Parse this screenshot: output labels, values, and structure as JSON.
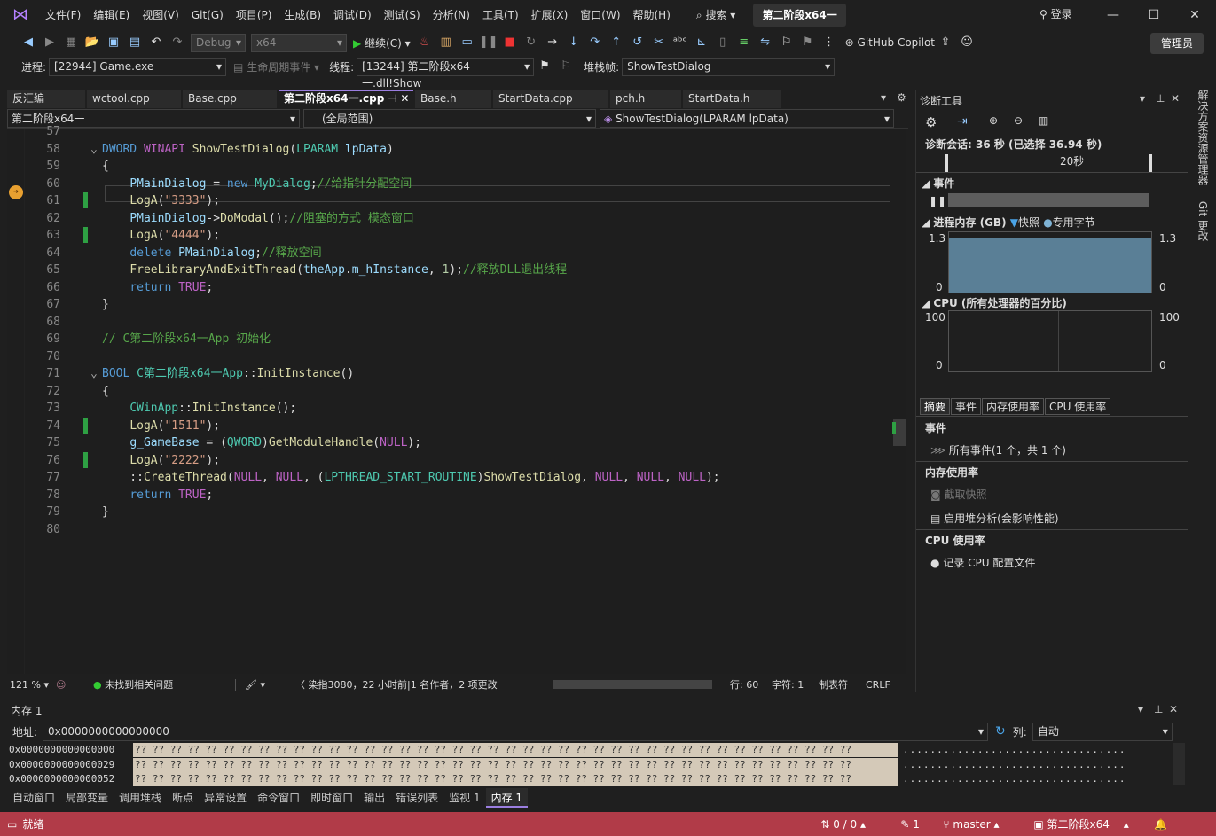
{
  "menu": [
    "文件(F)",
    "编辑(E)",
    "视图(V)",
    "Git(G)",
    "项目(P)",
    "生成(B)",
    "调试(D)",
    "测试(S)",
    "分析(N)",
    "工具(T)",
    "扩展(X)",
    "窗口(W)",
    "帮助(H)"
  ],
  "search_label": "搜索",
  "project_title": "第二阶段x64一",
  "login_label": "登录",
  "toolbar": {
    "config": "Debug",
    "platform": "x64",
    "continue_label": "继续(C)",
    "copilot_label": "GitHub Copilot",
    "admin_label": "管理员"
  },
  "debugbar": {
    "process_label": "进程:",
    "process_value": "[22944] Game.exe",
    "lifecycle_label": "生命周期事件",
    "thread_label": "线程:",
    "thread_value": "[13244] 第二阶段x64一.dll!Show",
    "stack_label": "堆栈帧:",
    "stack_value": "ShowTestDialog"
  },
  "tabs": [
    {
      "label": "反汇编",
      "active": false
    },
    {
      "label": "wctool.cpp",
      "active": false
    },
    {
      "label": "Base.cpp",
      "active": false
    },
    {
      "label": "第二阶段x64一.cpp",
      "active": true
    },
    {
      "label": "Base.h",
      "active": false
    },
    {
      "label": "StartData.cpp",
      "active": false
    },
    {
      "label": "pch.h",
      "active": false
    },
    {
      "label": "StartData.h",
      "active": false
    }
  ],
  "navbar": {
    "project": "第二阶段x64一",
    "scope": "(全局范围)",
    "function": "ShowTestDialog(LPARAM lpData)"
  },
  "editor": {
    "lines": [
      {
        "n": "57",
        "html": ""
      },
      {
        "n": "58",
        "html": "<span class='kw'>DWORD</span> <span class='mc'>WINAPI</span> <span class='fn'>ShowTestDialog</span>(<span class='ty'>LPARAM</span> <span class='mb'>lpData</span>)"
      },
      {
        "n": "59",
        "html": "{"
      },
      {
        "n": "60",
        "html": "    <span class='mb'>PMainDialog</span> = <span class='kw'>new</span> <span class='ty'>MyDialog</span>;<span class='cm'>//给指针分配空间</span>"
      },
      {
        "n": "61",
        "html": "    <span class='fn'>LogA</span>(<span class='st'>\"3333\"</span>);"
      },
      {
        "n": "62",
        "html": "    <span class='mb'>PMainDialog</span>-&gt;<span class='fn'>DoModal</span>();<span class='cm'>//阻塞的方式 模态窗口</span>"
      },
      {
        "n": "63",
        "html": "    <span class='fn'>LogA</span>(<span class='st'>\"4444\"</span>);"
      },
      {
        "n": "64",
        "html": "    <span class='kw'>delete</span> <span class='mb'>PMainDialog</span>;<span class='cm'>//释放空间</span>"
      },
      {
        "n": "65",
        "html": "    <span class='fn'>FreeLibraryAndExitThread</span>(<span class='mb'>theApp</span>.<span class='mb'>m_hInstance</span>, <span class='nu'>1</span>);<span class='cm'>//释放DLL退出线程</span>"
      },
      {
        "n": "66",
        "html": "    <span class='kw'>return</span> <span class='mc'>TRUE</span>;"
      },
      {
        "n": "67",
        "html": "}"
      },
      {
        "n": "68",
        "html": ""
      },
      {
        "n": "69",
        "html": "<span class='cm'>// C第二阶段x64一App 初始化</span>"
      },
      {
        "n": "70",
        "html": ""
      },
      {
        "n": "71",
        "html": "<span class='kw'>BOOL</span> <span class='ty'>C第二阶段x64一App</span>::<span class='fn'>InitInstance</span>()"
      },
      {
        "n": "72",
        "html": "{"
      },
      {
        "n": "73",
        "html": "    <span class='ty'>CWinApp</span>::<span class='fn'>InitInstance</span>();"
      },
      {
        "n": "74",
        "html": "    <span class='fn'>LogA</span>(<span class='st'>\"1511\"</span>);"
      },
      {
        "n": "75",
        "html": "    <span class='mb'>g_GameBase</span> = (<span class='ty'>QWORD</span>)<span class='fn'>GetModuleHandle</span>(<span class='mc'>NULL</span>);"
      },
      {
        "n": "76",
        "html": "    <span class='fn'>LogA</span>(<span class='st'>\"2222\"</span>);"
      },
      {
        "n": "77",
        "html": "    ::<span class='fn'>CreateThread</span>(<span class='mc'>NULL</span>, <span class='mc'>NULL</span>, (<span class='ty'>LPTHREAD_START_ROUTINE</span>)<span class='fn'>ShowTestDialog</span>, <span class='mc'>NULL</span>, <span class='mc'>NULL</span>, <span class='mc'>NULL</span>);"
      },
      {
        "n": "78",
        "html": "    <span class='kw'>return</span> <span class='mc'>TRUE</span>;"
      },
      {
        "n": "79",
        "html": "}"
      },
      {
        "n": "80",
        "html": ""
      }
    ]
  },
  "editor_status": {
    "zoom": "121 %",
    "issues": "未找到相关问题",
    "blame": "染指3080，22 小时前|1 名作者，2 项更改",
    "line": "行: 60",
    "char": "字符: 1",
    "tab": "制表符",
    "eol": "CRLF"
  },
  "diag": {
    "title": "诊断工具",
    "session": "诊断会话: 36 秒 (已选择 36.94 秒)",
    "timeline_label": "20秒",
    "events_label": "事件",
    "memory_label": "进程内存 (GB)",
    "snapshot_label": "快照",
    "private_label": "专用字节",
    "mem_max_left": "1.3",
    "mem_min_left": "0",
    "mem_max_right": "1.3",
    "mem_min_right": "0",
    "cpu_label": "CPU (所有处理器的百分比)",
    "cpu_max_left": "100",
    "cpu_min_left": "0",
    "cpu_max_right": "100",
    "cpu_min_right": "0",
    "tabs": [
      "摘要",
      "事件",
      "内存使用率",
      "CPU 使用率"
    ],
    "sec_events": "事件",
    "all_events": "所有事件(1 个，共 1 个)",
    "sec_memory": "内存使用率",
    "take_snapshot": "截取快照",
    "heap_profiling": "启用堆分析(会影响性能)",
    "sec_cpu": "CPU 使用率",
    "record_cpu": "记录 CPU 配置文件"
  },
  "side_tabs": [
    "解决方案资源管理器",
    "Git 更改"
  ],
  "memory": {
    "title": "内存 1",
    "addr_label": "地址:",
    "addr_value": "0x0000000000000000",
    "col_label": "列:",
    "col_value": "自动",
    "rows": [
      {
        "addr": "0x0000000000000000",
        "hex": "?? ?? ?? ?? ?? ?? ?? ?? ?? ?? ?? ?? ?? ?? ?? ?? ?? ?? ?? ?? ?? ?? ?? ?? ?? ?? ?? ?? ?? ?? ?? ?? ?? ?? ?? ?? ?? ?? ?? ?? ??",
        "chars": "................................."
      },
      {
        "addr": "0x0000000000000029",
        "hex": "?? ?? ?? ?? ?? ?? ?? ?? ?? ?? ?? ?? ?? ?? ?? ?? ?? ?? ?? ?? ?? ?? ?? ?? ?? ?? ?? ?? ?? ?? ?? ?? ?? ?? ?? ?? ?? ?? ?? ?? ??",
        "chars": "................................."
      },
      {
        "addr": "0x0000000000000052",
        "hex": "?? ?? ?? ?? ?? ?? ?? ?? ?? ?? ?? ?? ?? ?? ?? ?? ?? ?? ?? ?? ?? ?? ?? ?? ?? ?? ?? ?? ?? ?? ?? ?? ?? ?? ?? ?? ?? ?? ?? ?? ??",
        "chars": "................................."
      }
    ]
  },
  "bottom_tabs": [
    {
      "label": "自动窗口",
      "active": false
    },
    {
      "label": "局部变量",
      "active": false
    },
    {
      "label": "调用堆栈",
      "active": false
    },
    {
      "label": "断点",
      "active": false
    },
    {
      "label": "异常设置",
      "active": false
    },
    {
      "label": "命令窗口",
      "active": false
    },
    {
      "label": "即时窗口",
      "active": false
    },
    {
      "label": "输出",
      "active": false
    },
    {
      "label": "错误列表",
      "active": false
    },
    {
      "label": "监视 1",
      "active": false
    },
    {
      "label": "内存 1",
      "active": true
    }
  ],
  "status": {
    "ready": "就绪",
    "sync": "0 / 0",
    "edits": "1",
    "branch": "master",
    "repo": "第二阶段x64一"
  },
  "colors": {
    "statusbar": "#b13b48",
    "accent": "#9b7ee0"
  }
}
